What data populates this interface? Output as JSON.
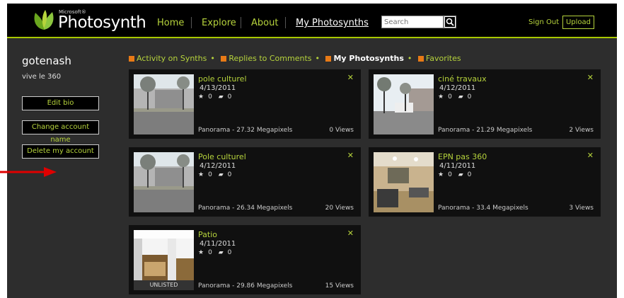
{
  "brand": {
    "microsoft": "Microsoft®",
    "name": "Photosynth"
  },
  "nav": [
    "Home",
    "Explore",
    "About",
    "My Photosynths"
  ],
  "search": {
    "placeholder": "Search"
  },
  "header": {
    "signout": "Sign Out",
    "upload": "Upload"
  },
  "user": {
    "name": "gotenash",
    "tagline": "vive le 360"
  },
  "sidebar_buttons": [
    "Edit bio",
    "Change account name",
    "Delete my account"
  ],
  "filters": [
    "Activity on Synths",
    "Replies to Comments",
    "My Photosynths",
    "Favorites"
  ],
  "cards": [
    {
      "title": "pole culturel",
      "date": "4/13/2011",
      "stars": "0",
      "comments": "0",
      "pano": "Panorama - 27.32 Megapixels",
      "views": "0 Views",
      "badge": ""
    },
    {
      "title": "ciné travaux",
      "date": "4/12/2011",
      "stars": "0",
      "comments": "0",
      "pano": "Panorama - 21.29 Megapixels",
      "views": "2 Views",
      "badge": ""
    },
    {
      "title": "Pole culturel",
      "date": "4/12/2011",
      "stars": "0",
      "comments": "0",
      "pano": "Panorama - 26.34 Megapixels",
      "views": "20 Views",
      "badge": ""
    },
    {
      "title": "EPN pas 360",
      "date": "4/11/2011",
      "stars": "0",
      "comments": "0",
      "pano": "Panorama - 33.4 Megapixels",
      "views": "3 Views",
      "badge": ""
    },
    {
      "title": "Patio",
      "date": "4/11/2011",
      "stars": "0",
      "comments": "0",
      "pano": "Panorama - 29.86 Megapixels",
      "views": "15 Views",
      "badge": "UNLISTED"
    }
  ],
  "colors": {
    "accent": "#b6d33c",
    "background": "#2d2d2d",
    "card": "#101010",
    "annotation": "#e00000"
  }
}
